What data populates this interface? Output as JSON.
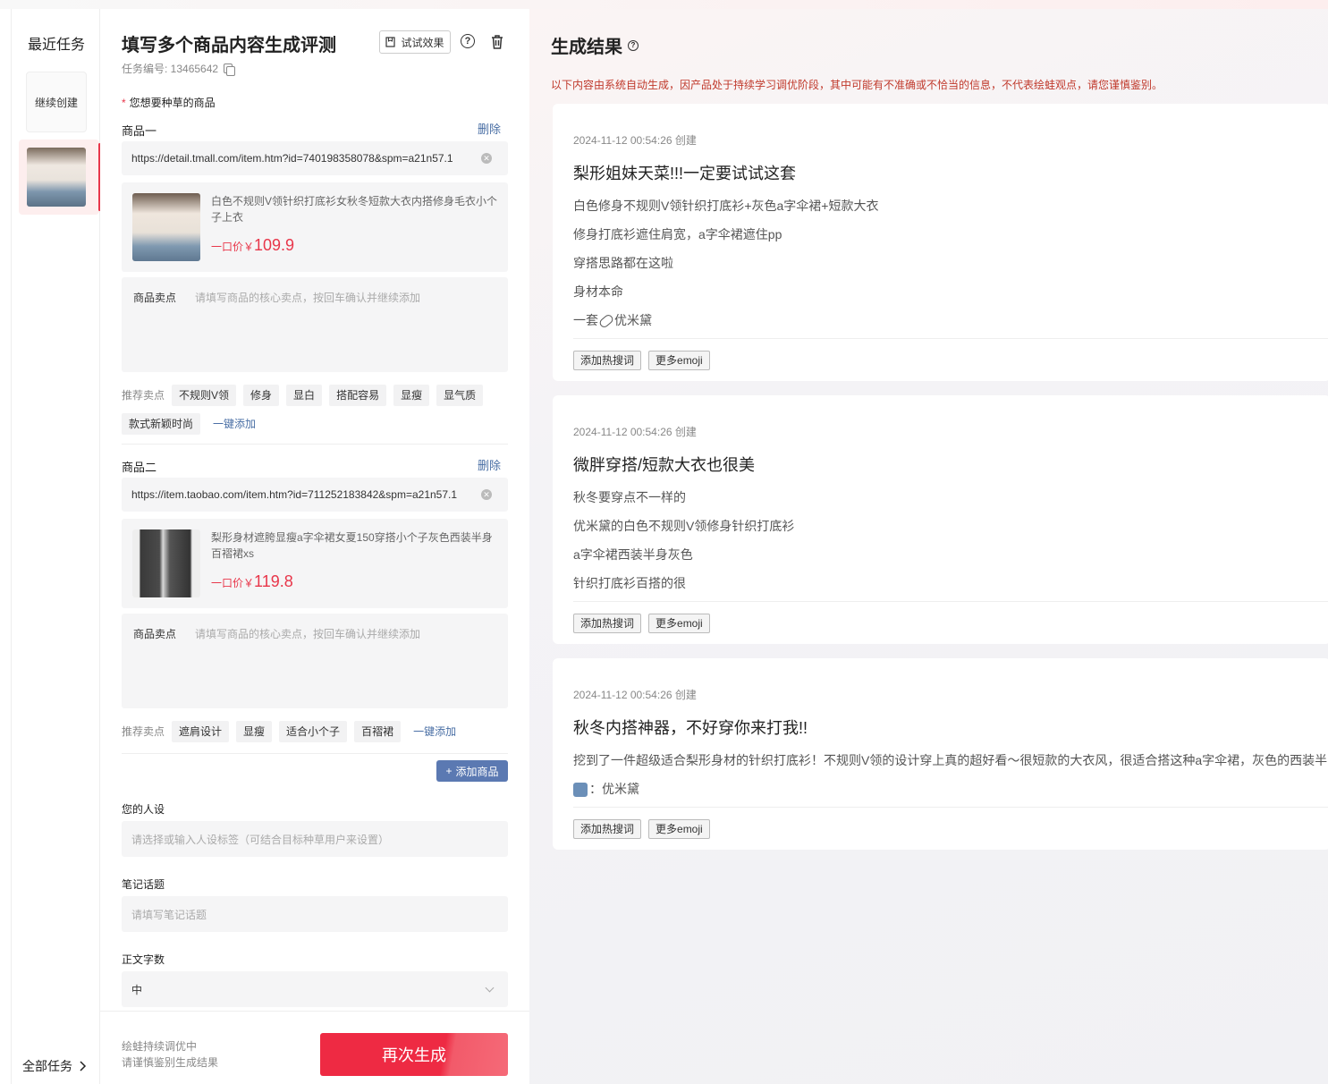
{
  "sidebar": {
    "title": "最近任务",
    "continue_label": "继续创建",
    "all_tasks_label": "全部任务"
  },
  "form": {
    "title": "填写多个商品内容生成评测",
    "try_label": "试试效果",
    "task_no": "任务编号: 13465642",
    "products_label": "您想要种草的商品",
    "delete_label": "删除",
    "selling_label": "商品卖点",
    "selling_placeholder": "请填写商品的核心卖点，按回车确认并继续添加",
    "recommend_label": "推荐卖点",
    "one_click_label": "一键添加",
    "products": [
      {
        "label": "商品一",
        "url": "https://detail.tmall.com/item.htm?id=740198358078&spm=a21n57.1",
        "name": "白色不规则V领针织打底衫女秋冬短款大衣内搭修身毛衣小个子上衣",
        "price_label": "一口价￥",
        "price": "109.9",
        "tags": [
          "不规则V领",
          "修身",
          "显白",
          "搭配容易",
          "显瘦",
          "显气质",
          "款式新颖时尚"
        ]
      },
      {
        "label": "商品二",
        "url": "https://item.taobao.com/item.htm?id=711252183842&spm=a21n57.1",
        "name": "梨形身材遮胯显瘦a字伞裙女夏150穿搭小个子灰色西装半身百褶裙xs",
        "price_label": "一口价￥",
        "price": "119.8",
        "tags": [
          "遮肩设计",
          "显瘦",
          "适合小个子",
          "百褶裙"
        ]
      }
    ],
    "add_product_label": "添加商品",
    "persona_label": "您的人设",
    "persona_placeholder": "请选择或输入人设标签（可结合目标种草用户来设置）",
    "topic_label": "笔记话题",
    "topic_placeholder": "请填写笔记话题",
    "wordcount_label": "正文字数",
    "wordcount_value": "中",
    "footer_note_1": "绘蛙持续调优中",
    "footer_note_2": "请谨慎鉴别生成结果",
    "regen_label": "再次生成"
  },
  "results": {
    "title": "生成结果",
    "disclaimer": "以下内容由系统自动生成，因产品处于持续学习调优阶段，其中可能有不准确或不恰当的信息，不代表绘蛙观点，请您谨慎鉴别。",
    "hot_words_label": "添加热搜词",
    "more_emoji_label": "更多emoji",
    "cards": [
      {
        "time": "2024-11-12 00:54:26 创建",
        "title": "梨形姐妹天菜!!!一定要试试这套",
        "lines": [
          "白色修身不规则V领针织打底衫+灰色a字伞裙+短款大衣",
          "修身打底衫遮住肩宽，a字伞裙遮住pp",
          "穿搭思路都在这啦",
          "身材本命"
        ],
        "link_prefix": "一套",
        "link_suffix": "优米黛"
      },
      {
        "time": "2024-11-12 00:54:26 创建",
        "title": "微胖穿搭/短款大衣也很美",
        "lines": [
          "秋冬要穿点不一样的",
          "优米黛的白色不规则V领修身针织打底衫",
          "a字伞裙西装半身灰色",
          "针织打底衫百搭的很"
        ]
      },
      {
        "time": "2024-11-12 00:54:26 创建",
        "title": "秋冬内搭神器，不好穿你来打我!!",
        "lines": [
          "挖到了一件超级适合梨形身材的针织打底衫！不规则V领的设计穿上真的超好看～很短款的大衣风，很适合搭这种a字伞裙，灰色的西装半"
        ],
        "person_suffix": "：优米黛"
      }
    ]
  }
}
